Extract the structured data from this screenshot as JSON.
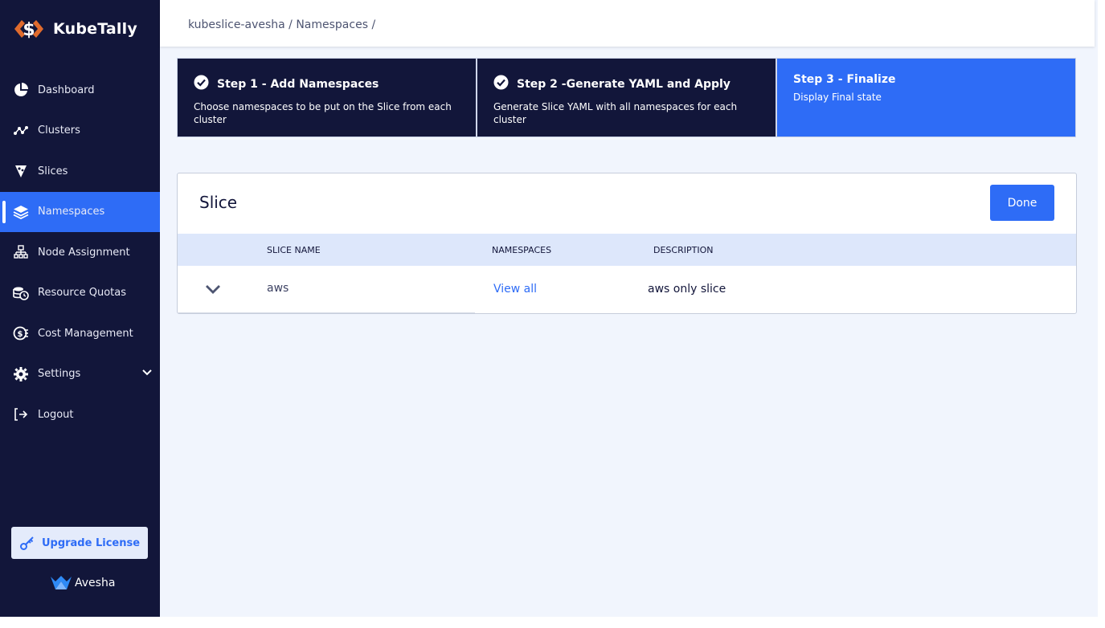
{
  "brand": {
    "name": "KubeTally"
  },
  "nav": [
    {
      "label": "Dashboard",
      "icon": "pie-chart-icon"
    },
    {
      "label": "Clusters",
      "icon": "network-icon"
    },
    {
      "label": "Slices",
      "icon": "slice-icon"
    },
    {
      "label": "Namespaces",
      "icon": "layers-icon",
      "active": true
    },
    {
      "label": "Node Assignment",
      "icon": "sitemap-icon"
    },
    {
      "label": "Resource Quotas",
      "icon": "coins-clock-icon"
    },
    {
      "label": "Cost Management",
      "icon": "money-icon"
    },
    {
      "label": "Settings",
      "icon": "gear-icon",
      "has_submenu": true
    },
    {
      "label": "Logout",
      "icon": "logout-icon"
    }
  ],
  "upgrade_label": "Upgrade License",
  "footer_brand": "Avesha",
  "breadcrumb": "kubeslice-avesha / Namespaces /",
  "steps": [
    {
      "title": "Step 1 - Add Namespaces",
      "desc": "Choose namespaces to be put on the Slice from each cluster",
      "status": "done"
    },
    {
      "title": "Step 2 -Generate YAML and Apply",
      "desc": "Generate Slice YAML with all namespaces for each cluster",
      "status": "done"
    },
    {
      "title": "Step 3 - Finalize",
      "desc": "Display Final state",
      "status": "current"
    }
  ],
  "card": {
    "title": "Slice",
    "done_label": "Done",
    "columns": [
      "SLICE NAME",
      "NAMESPACES",
      "DESCRIPTION"
    ],
    "rows": [
      {
        "slice_name": "aws",
        "namespaces_link": "View all",
        "description": "aws only slice"
      }
    ]
  },
  "colors": {
    "sidebar": "#12163a",
    "accent": "#2e6cf6",
    "background": "#f1f5fd",
    "brand_orange": "#e06b2d"
  }
}
